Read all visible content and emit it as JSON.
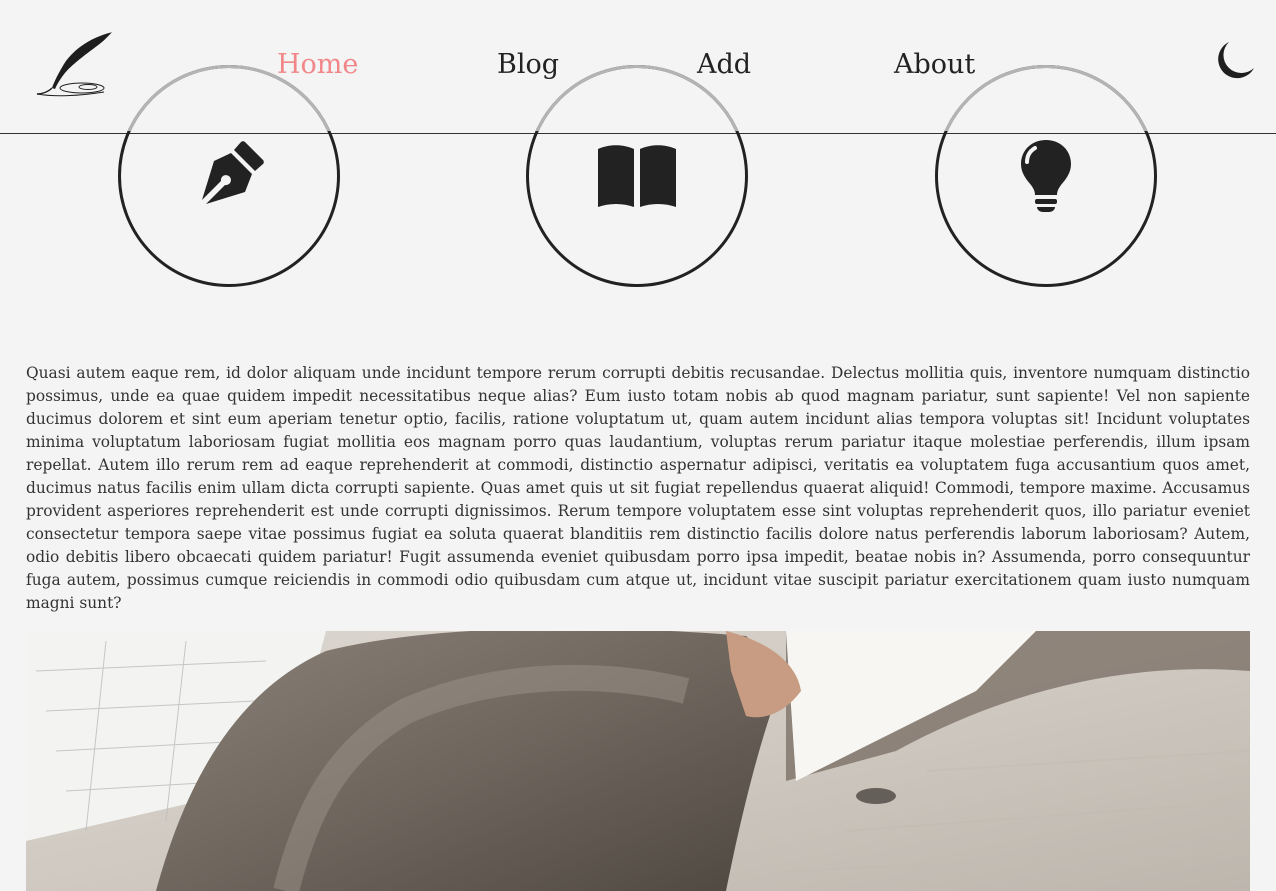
{
  "nav": {
    "items": [
      {
        "label": "Home",
        "active": true
      },
      {
        "label": "Blog",
        "active": false
      },
      {
        "label": "Add",
        "active": false
      },
      {
        "label": "About",
        "active": false
      }
    ],
    "active_color": "#f2878a"
  },
  "icons": {
    "logo": "quill-logo-icon",
    "theme_toggle": "moon-icon",
    "features": [
      "fountain-pen-icon",
      "open-book-icon",
      "lightbulb-icon"
    ]
  },
  "intro": {
    "text": "Quasi autem eaque rem, id dolor aliquam unde incidunt tempore rerum corrupti debitis recusandae. Delectus mollitia quis, inventore numquam distinctio possimus, unde ea quae quidem impedit necessitatibus neque alias? Eum iusto totam nobis ab quod magnam pariatur, sunt sapiente! Vel non sapiente ducimus dolorem et sint eum aperiam tenetur optio, facilis, ratione voluptatum ut, quam autem incidunt alias tempora voluptas sit! Incidunt voluptates minima voluptatum laboriosam fugiat mollitia eos magnam porro quas laudantium, voluptas rerum pariatur itaque molestiae perferendis, illum ipsam repellat. Autem illo rerum rem ad eaque reprehenderit at commodi, distinctio aspernatur adipisci, veritatis ea voluptatem fuga accusantium quos amet, ducimus natus facilis enim ullam dicta corrupti sapiente. Quas amet quis ut sit fugiat repellendus quaerat aliquid! Commodi, tempore maxime. Accusamus provident asperiores reprehenderit est unde corrupti dignissimos. Rerum tempore voluptatem esse sint voluptas reprehenderit quos, illo pariatur eveniet consectetur tempora saepe vitae possimus fugiat ea soluta quaerat blanditiis rem distinctio facilis dolore natus perferendis laborum laboriosam? Autem, odio debitis libero obcaecati quidem pariatur! Fugit assumenda eveniet quibusdam porro ipsa impedit, beatae nobis in? Assumenda, porro consequuntur fuga autem, possimus cumque reiciendis in commodi odio quibusdam cum atque ut, incidunt vitae suscipit pariatur exercitationem quam iusto numquam magni sunt?"
  }
}
